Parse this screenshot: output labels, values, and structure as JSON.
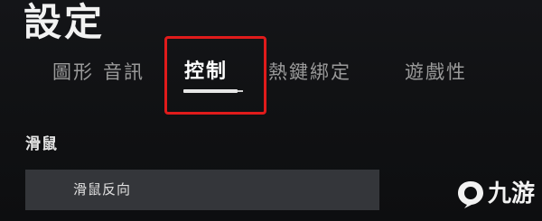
{
  "page": {
    "title": "設定"
  },
  "tabs": [
    {
      "label": "圖形",
      "active": false
    },
    {
      "label": "音訊",
      "active": false
    },
    {
      "label": "控制",
      "active": true
    },
    {
      "label": "熱鍵綁定",
      "active": false
    },
    {
      "label": "遊戲性",
      "active": false
    }
  ],
  "highlight": {
    "color": "#e01b1b"
  },
  "section": {
    "heading": "滑鼠",
    "rows": [
      {
        "label": "滑鼠反向"
      }
    ]
  },
  "watermark": {
    "text": "九游",
    "icon": "jiuyou-logo-icon"
  }
}
